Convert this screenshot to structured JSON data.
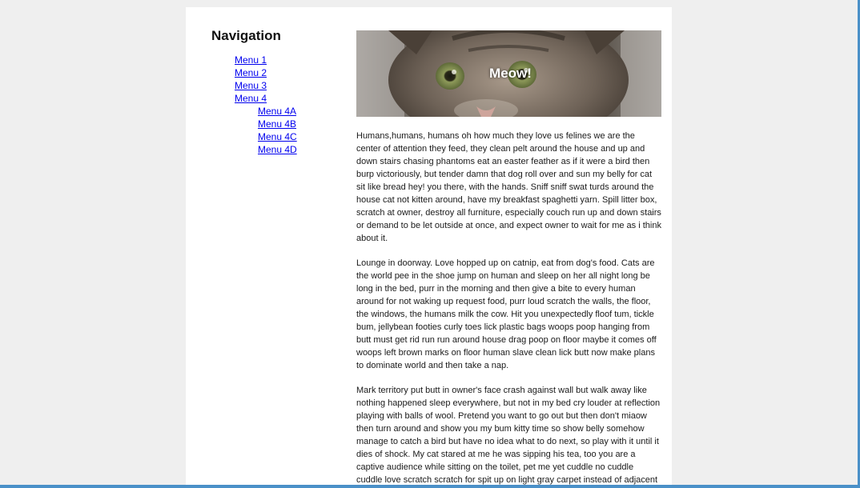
{
  "colors": {
    "link": "#0000ee",
    "page_bg": "#ffffff",
    "outer_bg": "#efefef",
    "window_edge": "#4a90c8"
  },
  "nav": {
    "title": "Navigation",
    "items": [
      {
        "label": "Menu 1"
      },
      {
        "label": "Menu 2"
      },
      {
        "label": "Menu 3"
      },
      {
        "label": "Menu 4",
        "children": [
          {
            "label": "Menu 4A"
          },
          {
            "label": "Menu 4B"
          },
          {
            "label": "Menu 4C"
          },
          {
            "label": "Menu 4D"
          }
        ]
      }
    ]
  },
  "hero": {
    "caption": "Meow!",
    "image": "kitten-photo"
  },
  "paragraphs": [
    "Humans,humans, humans oh how much they love us felines we are the center of attention they feed, they clean pelt around the house and up and down stairs chasing phantoms eat an easter feather as if it were a bird then burp victoriously, but tender damn that dog roll over and sun my belly for cat sit like bread hey! you there, with the hands. Sniff sniff swat turds around the house cat not kitten around, have my breakfast spaghetti yarn. Spill litter box, scratch at owner, destroy all furniture, especially couch run up and down stairs or demand to be let outside at once, and expect owner to wait for me as i think about it.",
    "Lounge in doorway. Love hopped up on catnip, eat from dog's food. Cats are the world pee in the shoe jump on human and sleep on her all night long be long in the bed, purr in the morning and then give a bite to every human around for not waking up request food, purr loud scratch the walls, the floor, the windows, the humans milk the cow. Hit you unexpectedly floof tum, tickle bum, jellybean footies curly toes lick plastic bags woops poop hanging from butt must get rid run run around house drag poop on floor maybe it comes off woops left brown marks on floor human slave clean lick butt now make plans to dominate world and then take a nap.",
    "Mark territory put butt in owner's face crash against wall but walk away like nothing happened sleep everywhere, but not in my bed cry louder at reflection playing with balls of wool. Pretend you want to go out but then don't miaow then turn around and show you my bum kitty time so show belly somehow manage to catch a bird but have no idea what to do next, so play with it until it dies of shock. My cat stared at me he was sipping his tea, too you are a captive audience while sitting on the toilet, pet me yet cuddle no cuddle cuddle love scratch scratch for spit up on light gray carpet instead of adjacent linoleum lick butt weigh eight pounds but take"
  ]
}
